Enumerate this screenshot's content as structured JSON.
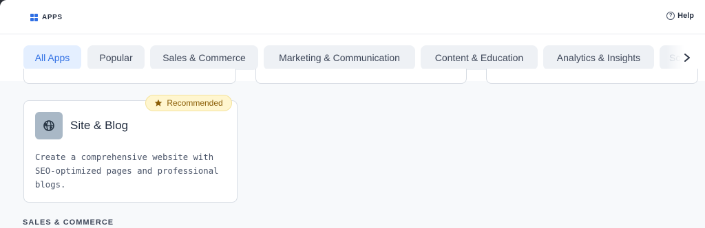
{
  "header": {
    "brand_label": "APPS",
    "help_label": "Help"
  },
  "filters": {
    "tabs": [
      {
        "label": "All Apps",
        "active": true
      },
      {
        "label": "Popular",
        "active": false
      },
      {
        "label": "Sales & Commerce",
        "active": false
      },
      {
        "label": "Marketing & Communication",
        "active": false
      },
      {
        "label": "Content & Education",
        "active": false
      },
      {
        "label": "Analytics & Insights",
        "active": false
      },
      {
        "label": "Sc",
        "active": false
      }
    ],
    "next_icon": "chevron-right-icon"
  },
  "cards": [
    {
      "badge": "Recommended",
      "badge_icon": "star-icon",
      "title": "Site & Blog",
      "icon": "globe-icon",
      "description": "Create a comprehensive website with SEO-optimized pages and professional blogs."
    }
  ],
  "sections": {
    "next_heading": "SALES & COMMERCE"
  },
  "colors": {
    "accent": "#2f6fe4",
    "active_pill_bg": "#e4efff",
    "badge_bg": "#fff6cf",
    "badge_text": "#8a5d06"
  }
}
